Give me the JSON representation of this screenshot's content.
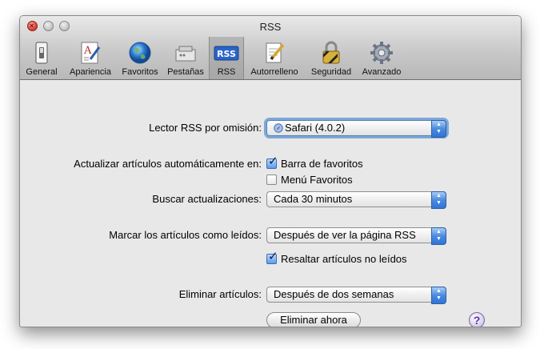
{
  "window": {
    "title": "RSS"
  },
  "toolbar": {
    "items": [
      {
        "label": "General",
        "icon": "switch-icon"
      },
      {
        "label": "Apariencia",
        "icon": "font-sheet-icon"
      },
      {
        "label": "Favoritos",
        "icon": "globe-icon"
      },
      {
        "label": "Pestañas",
        "icon": "tabs-icon"
      },
      {
        "label": "RSS",
        "icon": "rss-icon"
      },
      {
        "label": "Autorrelleno",
        "icon": "pencil-form-icon"
      },
      {
        "label": "Seguridad",
        "icon": "padlock-icon"
      },
      {
        "label": "Avanzado",
        "icon": "gear-icon"
      }
    ],
    "selected": "RSS",
    "rss_badge": "RSS"
  },
  "form": {
    "reader_label": "Lector RSS por omisión:",
    "reader_value": "Safari (4.0.2)",
    "update_label": "Actualizar artículos automáticamente en:",
    "update_bookmarks_bar": "Barra de favoritos",
    "update_bookmarks_bar_checked": true,
    "update_bookmarks_menu": "Menú Favoritos",
    "update_bookmarks_menu_checked": false,
    "check_label": "Buscar actualizaciones:",
    "check_value": "Cada 30 minutos",
    "mark_label": "Marcar los artículos como leídos:",
    "mark_value": "Después de ver la página RSS",
    "highlight_unread": "Resaltar artículos no leídos",
    "highlight_unread_checked": true,
    "remove_label": "Eliminar artículos:",
    "remove_value": "Después de dos semanas",
    "remove_now_button": "Eliminar ahora",
    "help_glyph": "?"
  },
  "colors": {
    "accent": "#3a7be0",
    "window_bg": "#e8e8e8"
  }
}
